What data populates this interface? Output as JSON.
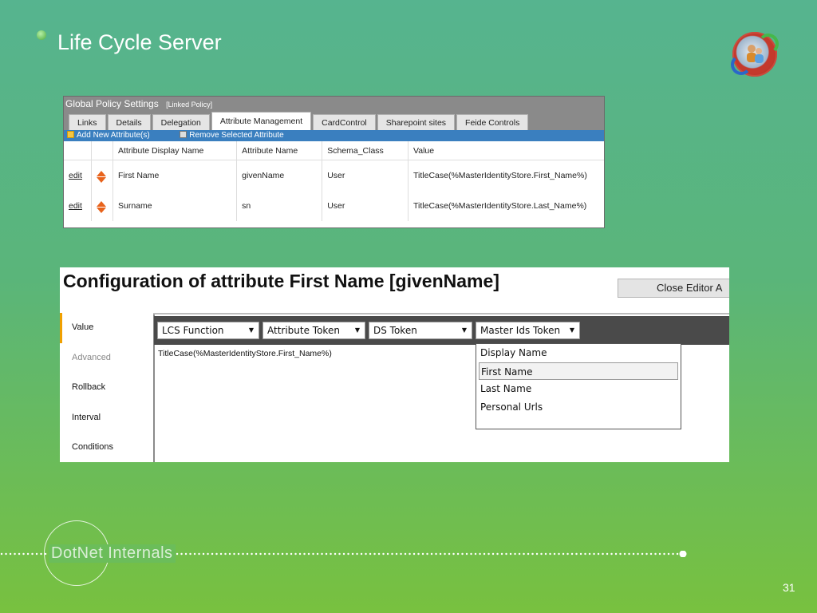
{
  "slide": {
    "title": "Life Cycle Server",
    "page_number": "31",
    "footer_logo": "DotNet Internals"
  },
  "policy_screen": {
    "header": "Global Policy Settings",
    "header_sub": "[Linked Policy]",
    "tabs": [
      "Links",
      "Details",
      "Delegation",
      "Attribute Management",
      "CardControl",
      "Sharepoint sites",
      "Feide Controls"
    ],
    "active_tab": "Attribute Management",
    "toolbar": {
      "add_label": "Add New Attribute(s)",
      "remove_label": "Remove Selected Attribute"
    },
    "columns": [
      "",
      "",
      "Attribute Display Name",
      "Attribute Name",
      "Schema_Class",
      "Value"
    ],
    "rows": [
      {
        "action": "edit",
        "display_name": "First Name",
        "attribute_name": "givenName",
        "schema_class": "User",
        "value": "TitleCase(%MasterIdentityStore.First_Name%)"
      },
      {
        "action": "edit",
        "display_name": "Surname",
        "attribute_name": "sn",
        "schema_class": "User",
        "value": "TitleCase(%MasterIdentityStore.Last_Name%)"
      }
    ]
  },
  "config_screen": {
    "title": "Configuration of attribute First Name [givenName]",
    "close_button": "Close Editor A",
    "sidebar": [
      "Value",
      "Advanced",
      "Rollback",
      "Interval",
      "Conditions"
    ],
    "active_sidebar": "Value",
    "dropdowns": [
      "LCS Function",
      "Attribute Token",
      "DS Token",
      "Master Ids Token"
    ],
    "editor_value": "TitleCase(%MasterIdentityStore.First_Name%)",
    "menu_items": [
      "Display Name",
      "First Name",
      "Last Name",
      "Personal Urls"
    ],
    "selected_menu_item": "First Name"
  },
  "colors": {
    "accent_blue": "#3a7fbf",
    "arrow_orange": "#e8631c",
    "active_tab_marker": "#f0a000"
  },
  "icons": [
    "bullet-icon",
    "lcs-logo-icon",
    "add-doc-icon",
    "trash-icon",
    "move-up-down-icon",
    "dropdown-caret-icon"
  ]
}
